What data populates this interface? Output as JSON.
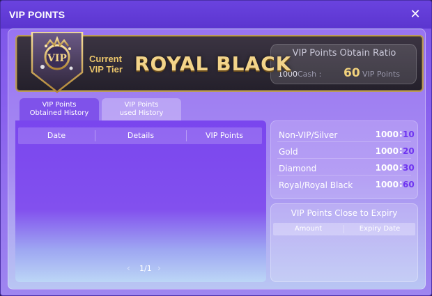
{
  "window": {
    "title": "VIP POINTS",
    "close_symbol": "✕"
  },
  "banner": {
    "caption": "Current\nVIP Tier",
    "tier_name": "ROYAL BLACK",
    "badge_text": "VIP",
    "ratio": {
      "title": "VIP Points Obtain Ratio",
      "cash_amount": "1000",
      "cash_label": "Cash :",
      "points_amount": "60",
      "points_label": "VIP Points"
    }
  },
  "tabs": [
    {
      "label": "VIP Points\nObtained History",
      "active": true
    },
    {
      "label": "VIP Points\nused History",
      "active": false
    }
  ],
  "history": {
    "columns": [
      "Date",
      "Details",
      "VIP Points"
    ],
    "rows": [],
    "pager": {
      "prev": "‹",
      "page": "1/1",
      "next": "›"
    }
  },
  "tier_ratios": [
    {
      "tier": "Non-VIP/Silver",
      "cash": "1000",
      "points": "10"
    },
    {
      "tier": "Gold",
      "cash": "1000",
      "points": "20"
    },
    {
      "tier": "Diamond",
      "cash": "1000",
      "points": "30"
    },
    {
      "tier": "Royal/Royal Black",
      "cash": "1000",
      "points": "60"
    }
  ],
  "expiry": {
    "title": "VIP Points Close to Expiry",
    "columns": [
      "Amount",
      "Expiry Date"
    ]
  },
  "colors": {
    "accent": "#7c55e8",
    "gold": "#f2d27c",
    "points_purple": "#6f35f0"
  }
}
